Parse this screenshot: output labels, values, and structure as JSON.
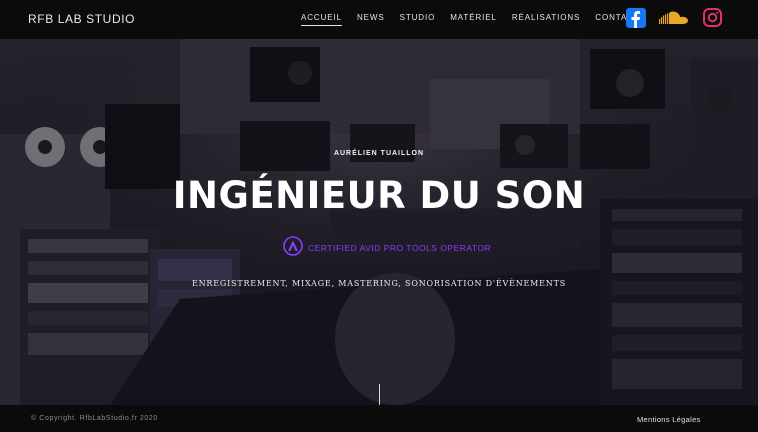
{
  "header": {
    "brand": "RFB LAB STUDIO",
    "nav": [
      {
        "label": "ACCUEIL",
        "active": true
      },
      {
        "label": "NEWS",
        "active": false
      },
      {
        "label": "STUDIO",
        "active": false
      },
      {
        "label": "MATÉRIEL",
        "active": false
      },
      {
        "label": "RÉALISATIONS",
        "active": false
      },
      {
        "label": "CONTACT",
        "active": false
      }
    ],
    "social": [
      {
        "icon": "facebook-icon",
        "color": "#1877f2"
      },
      {
        "icon": "soundcloud-icon",
        "color": "#e9a825"
      },
      {
        "icon": "instagram-icon",
        "color": "#e1306c"
      }
    ]
  },
  "hero": {
    "eyebrow": "AURÉLIEN TUAILLON",
    "title": "INGÉNIEUR DU SON",
    "cert_icon": "avid-logo-icon",
    "cert_text": "CERTIFIED AVID PRO TOOLS OPERATOR",
    "cert_color": "#8a3cff",
    "subtitle": "ENREGISTREMENT, MIXAGE, MASTERING, SONORISATION D'ÉVÈNEMENTS"
  },
  "footer": {
    "copyright": "© Copyright. RfbLabStudio.fr 2020",
    "legal": "Mentions Légales"
  }
}
